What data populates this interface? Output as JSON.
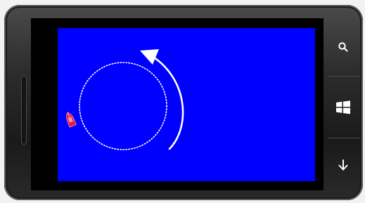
{
  "device": {
    "type": "windows-phone-emulator",
    "orientation": "landscape"
  },
  "game": {
    "background_color": "#0000ff",
    "guide_circle": {
      "style": "dotted",
      "color": "#ffffff"
    },
    "direction_arrow": {
      "direction": "counter-clockwise",
      "color": "#ffffff"
    },
    "player_boat": {
      "color": "#e01b4a"
    }
  },
  "hardware_buttons": [
    {
      "name": "search",
      "icon": "search-icon"
    },
    {
      "name": "start",
      "icon": "windows-start-icon"
    },
    {
      "name": "back",
      "icon": "back-arrow-icon"
    }
  ]
}
